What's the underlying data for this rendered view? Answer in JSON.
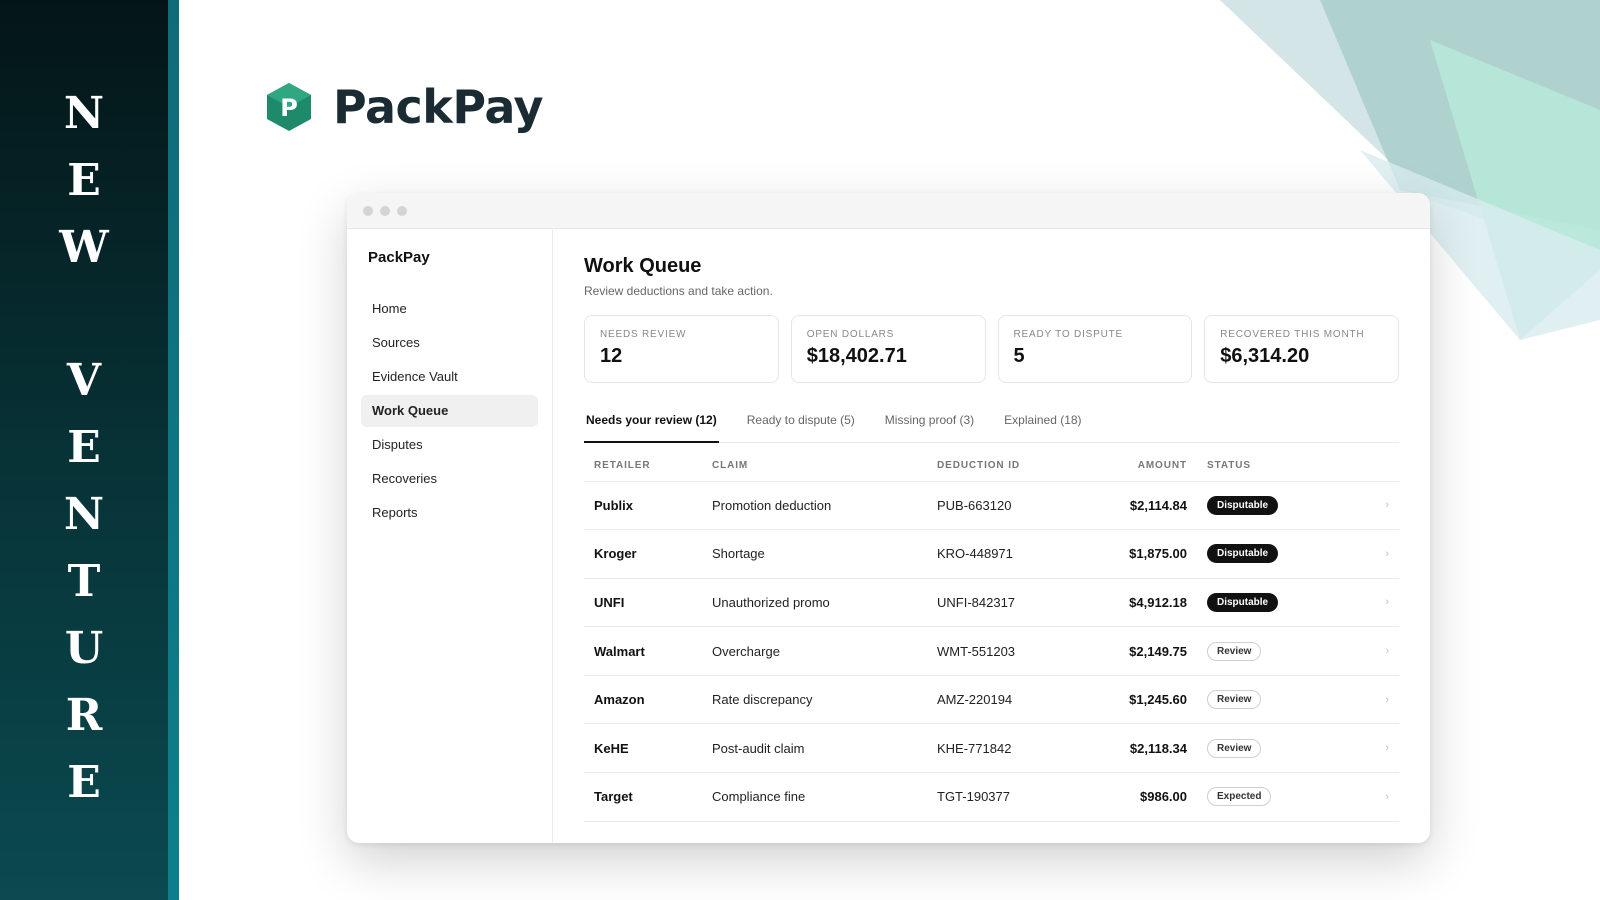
{
  "band": {
    "letters": [
      "N",
      "E",
      "W",
      "V",
      "E",
      "N",
      "T",
      "U",
      "R",
      "E"
    ]
  },
  "logo": {
    "wordmark": "PackPay",
    "mark_letter": "P",
    "color": "#1f8a6b"
  },
  "sidebar": {
    "brand": "PackPay",
    "items": [
      {
        "label": "Home"
      },
      {
        "label": "Sources"
      },
      {
        "label": "Evidence Vault"
      },
      {
        "label": "Work Queue",
        "active": true
      },
      {
        "label": "Disputes"
      },
      {
        "label": "Recoveries"
      },
      {
        "label": "Reports"
      }
    ]
  },
  "main": {
    "title": "Work Queue",
    "subtitle": "Review deductions and take action.",
    "stats": [
      {
        "label": "NEEDS REVIEW",
        "value": "12"
      },
      {
        "label": "OPEN DOLLARS",
        "value": "$18,402.71"
      },
      {
        "label": "READY TO DISPUTE",
        "value": "5"
      },
      {
        "label": "RECOVERED THIS MONTH",
        "value": "$6,314.20"
      }
    ],
    "tabs": [
      {
        "label": "Needs your review (12)",
        "active": true
      },
      {
        "label": "Ready to dispute (5)"
      },
      {
        "label": "Missing proof (3)"
      },
      {
        "label": "Explained (18)"
      }
    ],
    "table": {
      "headers": {
        "retailer": "RETAILER",
        "claim": "CLAIM",
        "deduction_id": "DEDUCTION ID",
        "amount": "AMOUNT",
        "status": "STATUS"
      },
      "rows": [
        {
          "retailer": "Publix",
          "claim": "Promotion deduction",
          "id": "PUB-663120",
          "amount": "$2,114.84",
          "status": "Disputable",
          "style": "dark"
        },
        {
          "retailer": "Kroger",
          "claim": "Shortage",
          "id": "KRO-448971",
          "amount": "$1,875.00",
          "status": "Disputable",
          "style": "dark"
        },
        {
          "retailer": "UNFI",
          "claim": "Unauthorized promo",
          "id": "UNFI-842317",
          "amount": "$4,912.18",
          "status": "Disputable",
          "style": "dark"
        },
        {
          "retailer": "Walmart",
          "claim": "Overcharge",
          "id": "WMT-551203",
          "amount": "$2,149.75",
          "status": "Review",
          "style": "light"
        },
        {
          "retailer": "Amazon",
          "claim": "Rate discrepancy",
          "id": "AMZ-220194",
          "amount": "$1,245.60",
          "status": "Review",
          "style": "light"
        },
        {
          "retailer": "KeHE",
          "claim": "Post-audit claim",
          "id": "KHE-771842",
          "amount": "$2,118.34",
          "status": "Review",
          "style": "light"
        },
        {
          "retailer": "Target",
          "claim": "Compliance fine",
          "id": "TGT-190377",
          "amount": "$986.00",
          "status": "Expected",
          "style": "light"
        }
      ]
    }
  }
}
